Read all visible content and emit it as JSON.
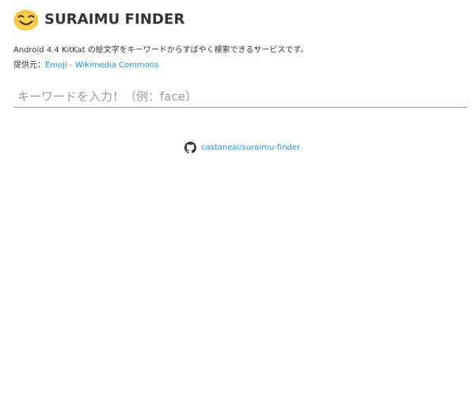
{
  "header": {
    "logo_icon": "smiling-face-emoji-icon",
    "title": "SURAIMU FINDER"
  },
  "description": "Android 4.4 KitKat の絵文字をキーワードからすばやく検索できるサービスです。",
  "credit": {
    "prefix": "提供元：",
    "link_text": "Emoji - Wikimedia Commons"
  },
  "search": {
    "placeholder": "キーワードを入力！（例：face）",
    "value": ""
  },
  "footer": {
    "repo_icon": "github-icon",
    "repo_link_text": "castaneai/suraimu-finder"
  },
  "colors": {
    "link": "#2b8fd6",
    "text": "#333333",
    "logo_yellow": "#f7c331"
  }
}
